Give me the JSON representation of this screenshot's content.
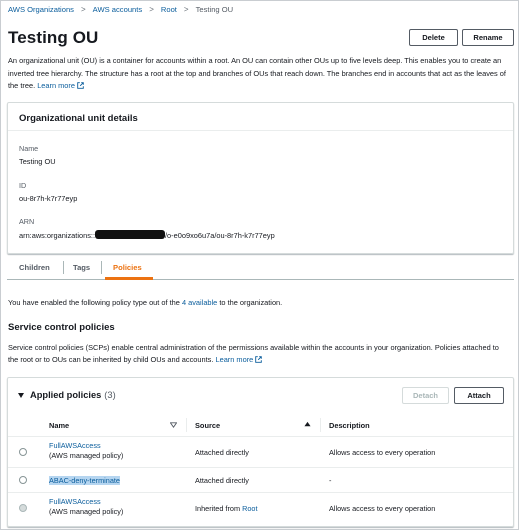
{
  "breadcrumb": {
    "items": [
      "AWS Organizations",
      "AWS accounts",
      "Root"
    ],
    "current": "Testing OU"
  },
  "page": {
    "title": "Testing OU",
    "delete_label": "Delete",
    "rename_label": "Rename",
    "intro_text": "An organizational unit (OU) is a container for accounts within a root. An OU can contain other OUs up to five levels deep. This enables you to create an inverted tree hierarchy. The structure has a root at the top and branches of OUs that reach down. The branches end in accounts that act as the leaves of the tree.",
    "learn_more": "Learn more"
  },
  "details": {
    "header": "Organizational unit details",
    "name_label": "Name",
    "name_value": "Testing OU",
    "id_label": "ID",
    "id_value": "ou-8r7h-k7r77eyp",
    "arn_label": "ARN",
    "arn_prefix": "arn:aws:organizations::",
    "arn_suffix": "/o-e0o9xo6u7a/ou-8r7h-k7r77eyp"
  },
  "tabs": [
    {
      "label": "Children"
    },
    {
      "label": "Tags"
    },
    {
      "label": "Policies",
      "active": true
    }
  ],
  "policies": {
    "enabled_prefix": "You have enabled the following policy type out of the",
    "enabled_link": "4 available",
    "enabled_suffix": "to the organization.",
    "scp_title": "Service control policies",
    "scp_desc": "Service control policies (SCPs) enable central administration of the permissions available within the accounts in your organization. Policies attached to the root or to OUs can be inherited by child OUs and accounts.",
    "learn_more": "Learn more"
  },
  "applied": {
    "title": "Applied policies",
    "count": "(3)",
    "detach_label": "Detach",
    "attach_label": "Attach",
    "columns": [
      "Name",
      "Source",
      "Description"
    ],
    "rows": [
      {
        "name": "FullAWSAccess",
        "sub": "(AWS managed policy)",
        "source": "Attached directly",
        "source_link": "",
        "description": "Allows access to every operation"
      },
      {
        "name": "ABAC-deny-terminate",
        "sub": "",
        "source": "Attached directly",
        "source_link": "",
        "description": "-"
      },
      {
        "name": "FullAWSAccess",
        "sub": "(AWS managed policy)",
        "source": "Inherited from",
        "source_link": "Root",
        "description": "Allows access to every operation"
      }
    ]
  },
  "colors": {
    "link": "#0a5d9c",
    "active_tab": "#ec7211",
    "highlight": "#b5d5f0"
  }
}
